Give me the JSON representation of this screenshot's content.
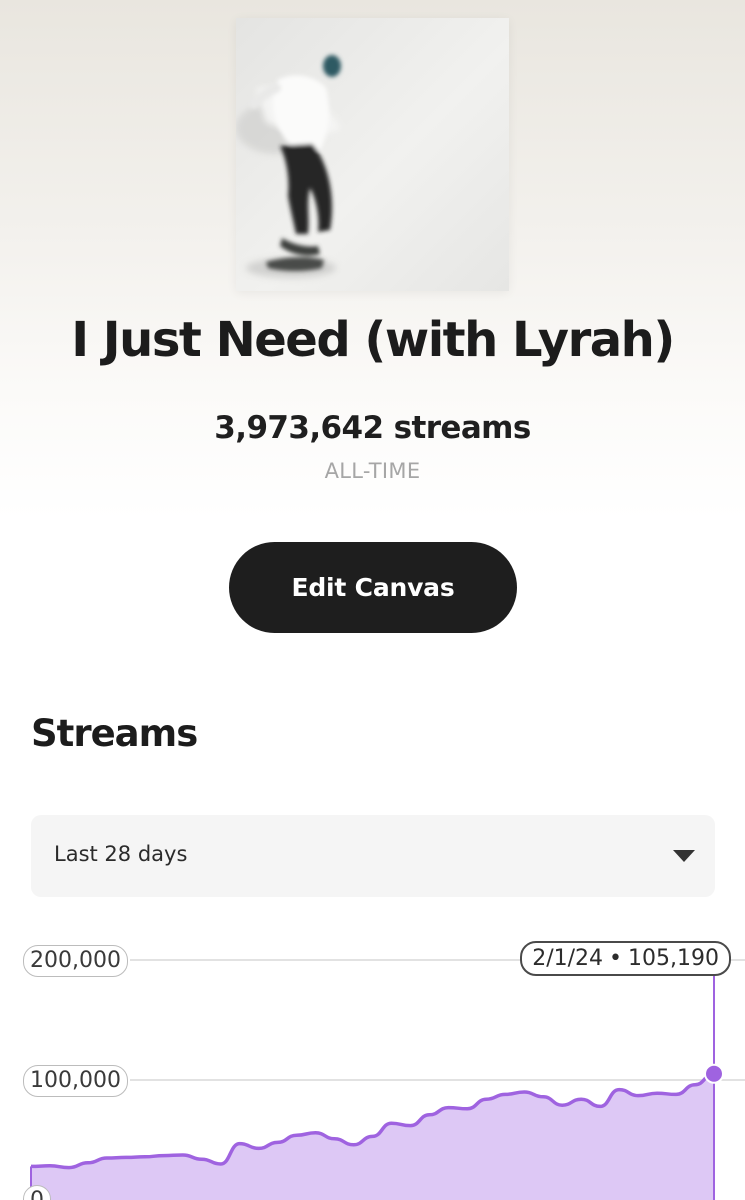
{
  "track": {
    "title": "I Just Need (with Lyrah)",
    "streams": "3,973,642 streams",
    "period": "ALL-TIME"
  },
  "actions": {
    "edit_canvas_label": "Edit Canvas"
  },
  "streams_section": {
    "title": "Streams",
    "range": {
      "selected": "Last 28 days",
      "icon": "caret-down-icon"
    }
  },
  "colors": {
    "accent": "#9f63e0",
    "fill": "#ddc8f5",
    "button": "#1e1e1e"
  },
  "chart_data": {
    "type": "area",
    "ylim": [
      0,
      200000
    ],
    "y_ticks": [
      "200,000",
      "100,000",
      "0"
    ],
    "grid": true,
    "tooltip": {
      "date": "2/1/24",
      "value": "105,190"
    },
    "series": [
      {
        "values": [
          28000,
          28500,
          27000,
          31000,
          35000,
          35500,
          36000,
          37000,
          37500,
          34000,
          30000,
          47000,
          43000,
          48000,
          54000,
          56000,
          51000,
          46000,
          53000,
          64000,
          62000,
          71000,
          77000,
          76000,
          84000,
          88000,
          90000,
          86000,
          79000,
          84000,
          78000,
          92000,
          87000,
          89000,
          88000,
          96000,
          105190
        ]
      }
    ]
  }
}
